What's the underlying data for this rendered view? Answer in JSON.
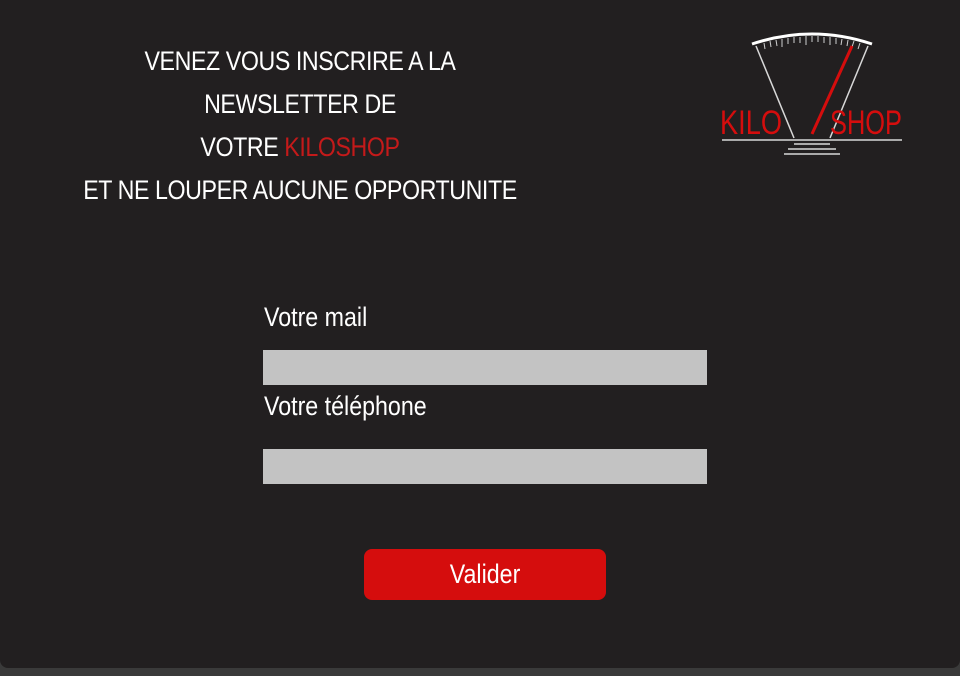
{
  "headline": {
    "line1": "VENEZ VOUS INSCRIRE A LA NEWSLETTER DE",
    "line2_prefix": "VOTRE ",
    "line2_brand": "KILOSHOP",
    "line3": "ET NE LOUPER AUCUNE OPPORTUNITE"
  },
  "logo": {
    "left_text": "KILO",
    "right_text": "SHOP",
    "icon": "scale-gauge-icon"
  },
  "form": {
    "mail_label": "Votre mail",
    "mail_value": "",
    "phone_label": "Votre téléphone",
    "phone_value": "",
    "submit_label": "Valider"
  },
  "colors": {
    "background": "#221f20",
    "accent": "#d50d0d",
    "brand_text": "#c41a1a",
    "field": "#c3c3c3",
    "text": "#ffffff"
  }
}
